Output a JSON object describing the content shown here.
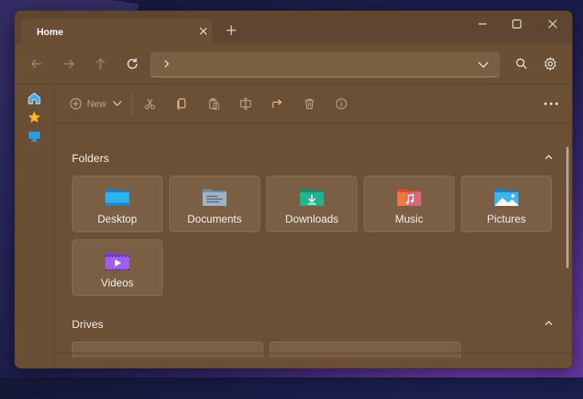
{
  "tab": {
    "title": "Home"
  },
  "address": {
    "path": ""
  },
  "toolbar": {
    "new_label": "New"
  },
  "sections": {
    "folders": {
      "title": "Folders"
    },
    "drives": {
      "title": "Drives"
    }
  },
  "folders": [
    {
      "label": "Desktop",
      "icon": "desktop-folder-icon"
    },
    {
      "label": "Documents",
      "icon": "documents-folder-icon"
    },
    {
      "label": "Downloads",
      "icon": "downloads-folder-icon"
    },
    {
      "label": "Music",
      "icon": "music-folder-icon"
    },
    {
      "label": "Pictures",
      "icon": "pictures-folder-icon"
    },
    {
      "label": "Videos",
      "icon": "videos-folder-icon"
    }
  ],
  "colors": {
    "window_bg": "#6a4f35",
    "titlebar_bg": "#5e4630",
    "card_bg": "#7a5f45",
    "text": "#f5efe8",
    "accent_blue": "#2a9ee0"
  }
}
